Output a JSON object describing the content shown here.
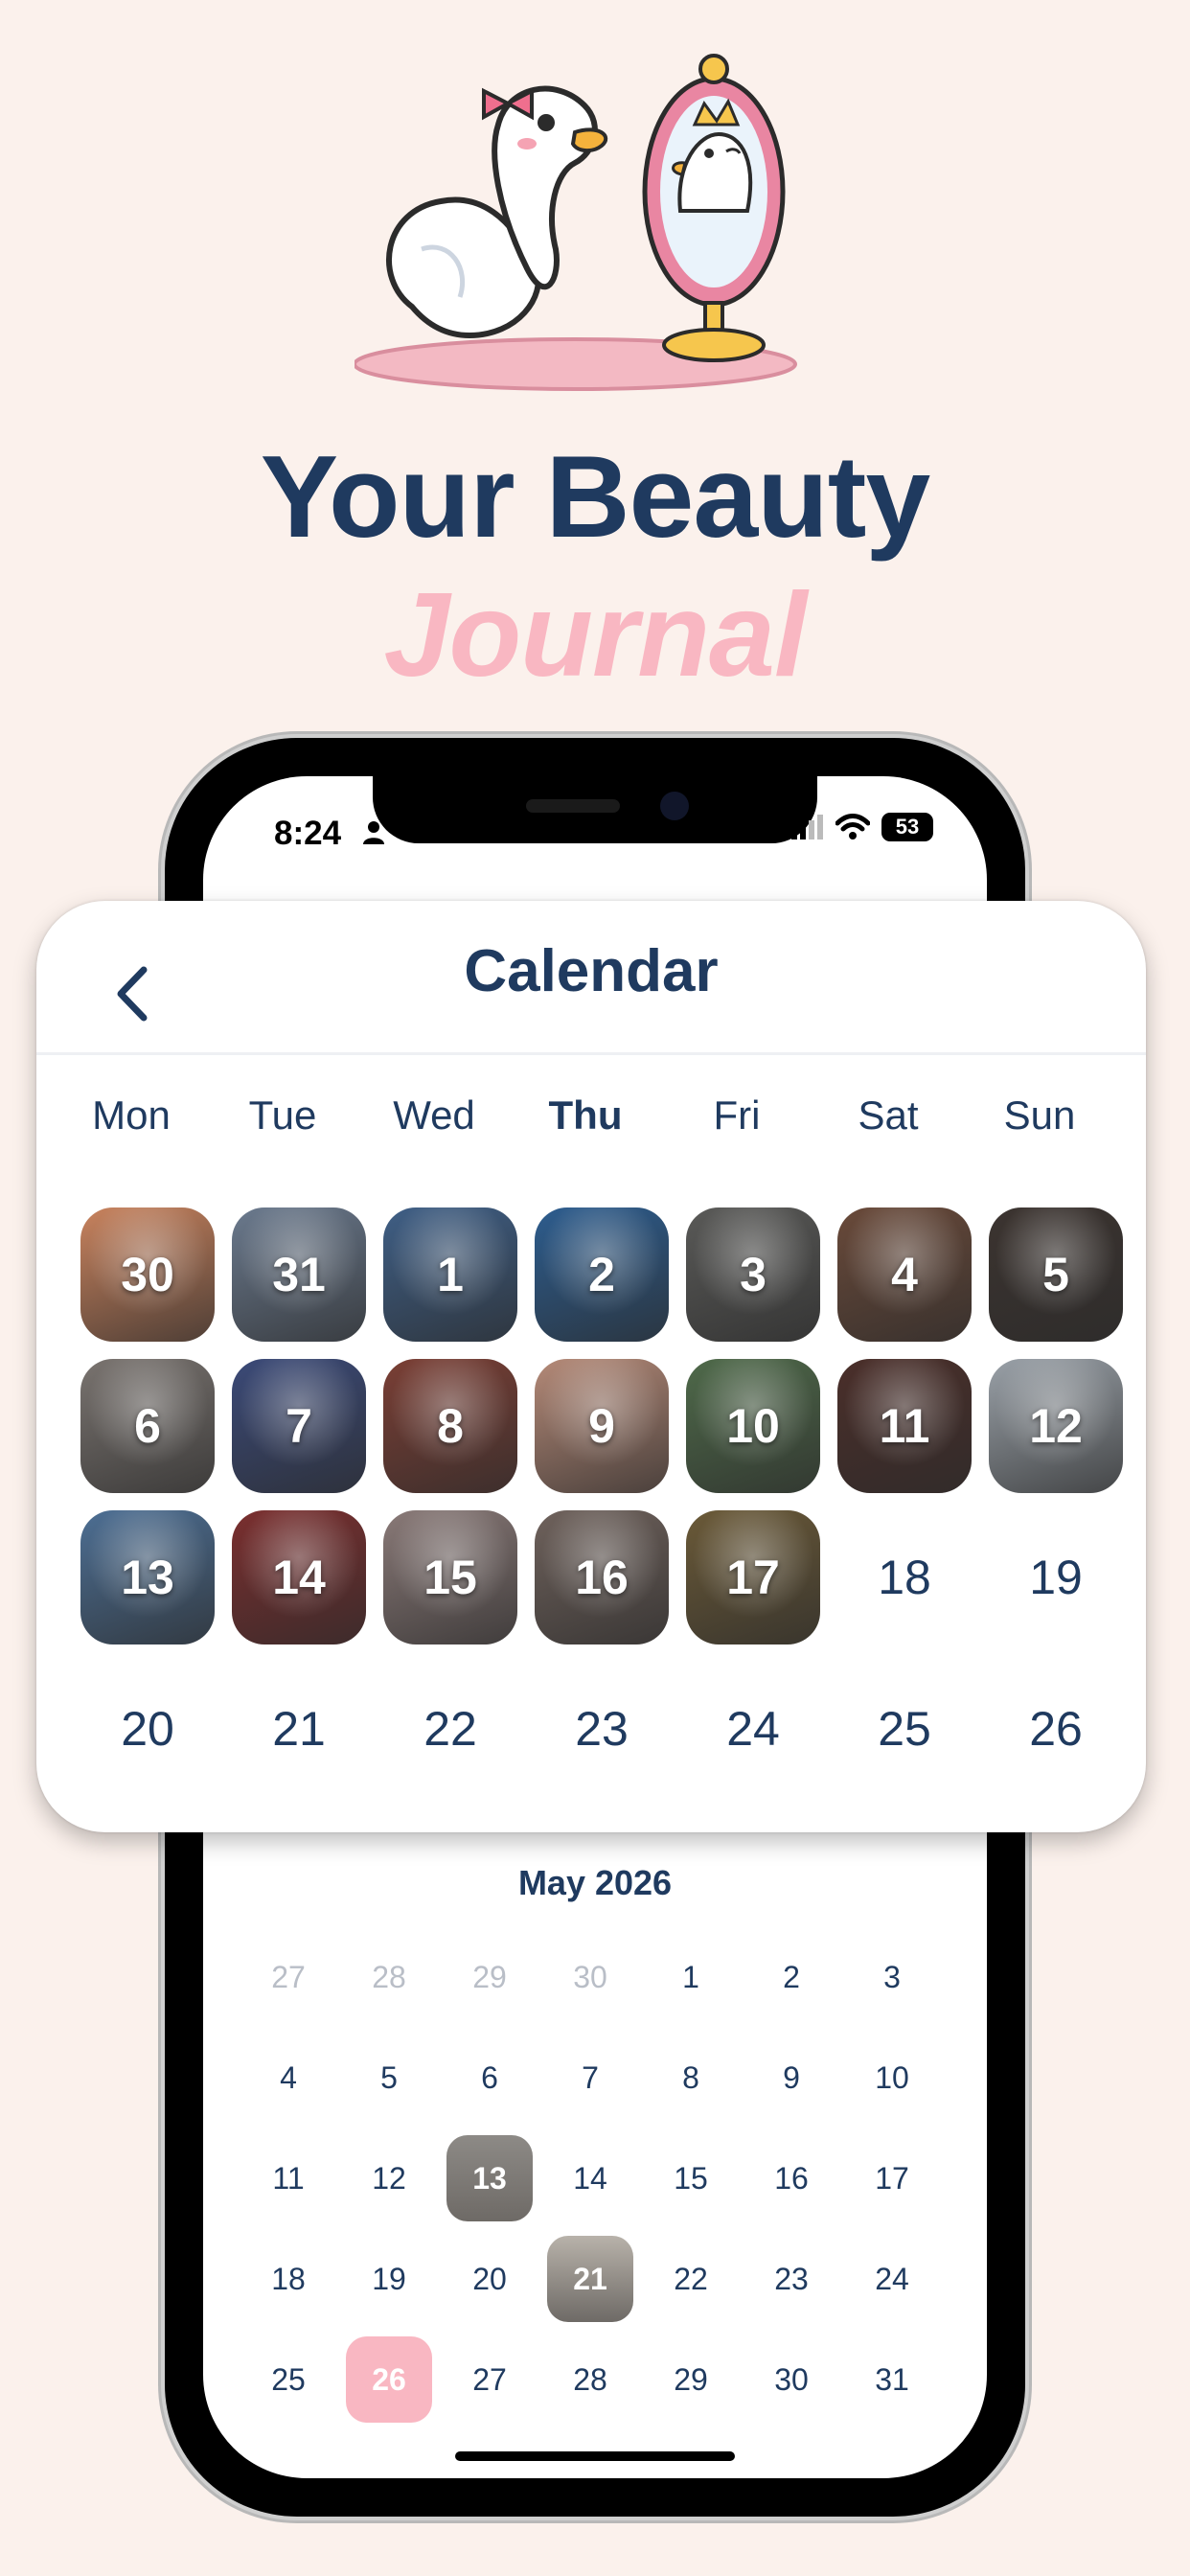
{
  "headline": {
    "main": "Your Beauty",
    "accent": "Journal"
  },
  "status_bar": {
    "time": "8:24",
    "battery": "53"
  },
  "card": {
    "title": "Calendar",
    "weekdays": [
      "Mon",
      "Tue",
      "Wed",
      "Thu",
      "Fri",
      "Sat",
      "Sun"
    ],
    "current_weekday": "Thu",
    "rows": [
      [
        {
          "label": "30",
          "photo": "#c9835e"
        },
        {
          "label": "31",
          "photo": "#6b7a8e"
        },
        {
          "label": "1",
          "photo": "#3f5f86"
        },
        {
          "label": "2",
          "photo": "#2d5d8f"
        },
        {
          "label": "3",
          "photo": "#5a5a58"
        },
        {
          "label": "4",
          "photo": "#6a4a3a"
        },
        {
          "label": "5",
          "photo": "#3c3430"
        }
      ],
      [
        {
          "label": "6",
          "photo": "#7a7470"
        },
        {
          "label": "7",
          "photo": "#3b4a78"
        },
        {
          "label": "8",
          "photo": "#7b3f35"
        },
        {
          "label": "9",
          "photo": "#b58a78"
        },
        {
          "label": "10",
          "photo": "#4f6a4a"
        },
        {
          "label": "11",
          "photo": "#4b2f2a"
        },
        {
          "label": "12",
          "photo": "#9aa1a8"
        }
      ],
      [
        {
          "label": "13",
          "photo": "#4d6f94"
        },
        {
          "label": "14",
          "photo": "#7b2f2f"
        },
        {
          "label": "15",
          "photo": "#8a7a78"
        },
        {
          "label": "16",
          "photo": "#6f625c"
        },
        {
          "label": "17",
          "photo": "#6b5a38"
        },
        {
          "label": "18",
          "photo": null
        },
        {
          "label": "19",
          "photo": null
        }
      ],
      [
        {
          "label": "20",
          "photo": null
        },
        {
          "label": "21",
          "photo": null
        },
        {
          "label": "22",
          "photo": null
        },
        {
          "label": "23",
          "photo": null
        },
        {
          "label": "24",
          "photo": null
        },
        {
          "label": "25",
          "photo": null
        },
        {
          "label": "26",
          "photo": null
        }
      ]
    ]
  },
  "month": {
    "title": "May 2026",
    "rows": [
      [
        {
          "label": "27",
          "muted": true
        },
        {
          "label": "28",
          "muted": true
        },
        {
          "label": "29",
          "muted": true
        },
        {
          "label": "30",
          "muted": true
        },
        {
          "label": "1"
        },
        {
          "label": "2"
        },
        {
          "label": "3"
        }
      ],
      [
        {
          "label": "4"
        },
        {
          "label": "5"
        },
        {
          "label": "6"
        },
        {
          "label": "7"
        },
        {
          "label": "8"
        },
        {
          "label": "9"
        },
        {
          "label": "10"
        }
      ],
      [
        {
          "label": "11"
        },
        {
          "label": "12"
        },
        {
          "label": "13",
          "photo": "#8d8a86"
        },
        {
          "label": "14"
        },
        {
          "label": "15"
        },
        {
          "label": "16"
        },
        {
          "label": "17"
        }
      ],
      [
        {
          "label": "18"
        },
        {
          "label": "19"
        },
        {
          "label": "20"
        },
        {
          "label": "21",
          "photo": "#b8b2aa"
        },
        {
          "label": "22"
        },
        {
          "label": "23"
        },
        {
          "label": "24"
        }
      ],
      [
        {
          "label": "25"
        },
        {
          "label": "26",
          "today": true
        },
        {
          "label": "27"
        },
        {
          "label": "28"
        },
        {
          "label": "29"
        },
        {
          "label": "30"
        },
        {
          "label": "31"
        }
      ]
    ]
  },
  "colors": {
    "navy": "#1f3a5f",
    "pink": "#f9b7c2",
    "background": "#fbf1ec"
  }
}
